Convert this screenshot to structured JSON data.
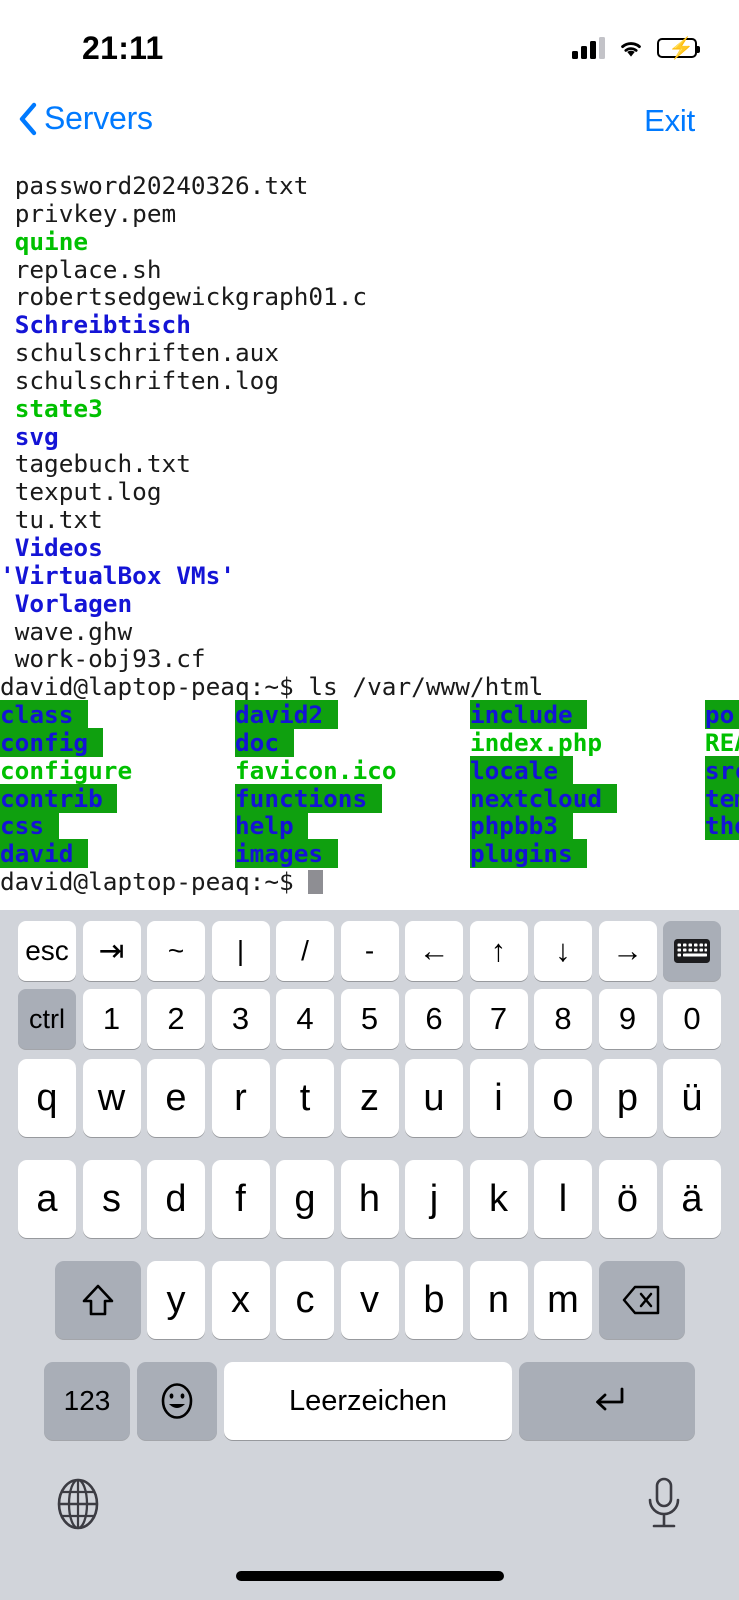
{
  "status_bar": {
    "time": "21:11",
    "cellular_icon": "cellular-bars-icon",
    "wifi_icon": "wifi-icon",
    "battery_icon": "battery-charging-icon"
  },
  "nav_bar": {
    "back_icon": "chevron-left-icon",
    "back_label": "Servers",
    "exit_label": "Exit",
    "accent_color": "#007aff"
  },
  "terminal": {
    "colors": {
      "file": "#1a1a1a",
      "directory": "#1414d6",
      "executable": "#00c000",
      "world_writable_dir_bg": "#0fa00f",
      "cursor": "#8e8e93",
      "background": "#ffffff"
    },
    "home_listing": [
      {
        "text": "password20240326.txt",
        "kind": "file"
      },
      {
        "text": "privkey.pem",
        "kind": "file"
      },
      {
        "text": "quine",
        "kind": "executable"
      },
      {
        "text": "replace.sh",
        "kind": "file"
      },
      {
        "text": "robertsedgewickgraph01.c",
        "kind": "file"
      },
      {
        "text": "Schreibtisch",
        "kind": "directory"
      },
      {
        "text": "schulschriften.aux",
        "kind": "file"
      },
      {
        "text": "schulschriften.log",
        "kind": "file"
      },
      {
        "text": "state3",
        "kind": "executable"
      },
      {
        "text": "svg",
        "kind": "directory"
      },
      {
        "text": "tagebuch.txt",
        "kind": "file"
      },
      {
        "text": "texput.log",
        "kind": "file"
      },
      {
        "text": "tu.txt",
        "kind": "file"
      },
      {
        "text": "Videos",
        "kind": "directory"
      },
      {
        "text": "'VirtualBox VMs'",
        "kind": "directory",
        "no_indent": true
      },
      {
        "text": "Vorlagen",
        "kind": "directory"
      },
      {
        "text": "wave.ghw",
        "kind": "file"
      },
      {
        "text": "work-obj93.cf",
        "kind": "file"
      }
    ],
    "command_line": {
      "prompt": "david@laptop-peaq:~$ ",
      "command": "ls /var/www/html"
    },
    "html_listing_columns": 4,
    "html_listing_rows": [
      [
        {
          "text": "class",
          "kind": "world_writable_dir"
        },
        {
          "text": "david2",
          "kind": "world_writable_dir"
        },
        {
          "text": "include",
          "kind": "world_writable_dir"
        },
        {
          "text": "po",
          "kind": "world_writable_dir"
        }
      ],
      [
        {
          "text": "config",
          "kind": "world_writable_dir"
        },
        {
          "text": "doc",
          "kind": "world_writable_dir"
        },
        {
          "text": "index.php",
          "kind": "executable"
        },
        {
          "text": "README",
          "kind": "executable"
        }
      ],
      [
        {
          "text": "configure",
          "kind": "executable"
        },
        {
          "text": "favicon.ico",
          "kind": "executable"
        },
        {
          "text": "locale",
          "kind": "world_writable_dir"
        },
        {
          "text": "src",
          "kind": "world_writable_dir"
        }
      ],
      [
        {
          "text": "contrib",
          "kind": "world_writable_dir"
        },
        {
          "text": "functions",
          "kind": "world_writable_dir"
        },
        {
          "text": "nextcloud",
          "kind": "world_writable_dir"
        },
        {
          "text": "templates",
          "kind": "world_writable_dir"
        }
      ],
      [
        {
          "text": "css",
          "kind": "world_writable_dir"
        },
        {
          "text": "help",
          "kind": "world_writable_dir"
        },
        {
          "text": "phpbb3",
          "kind": "world_writable_dir"
        },
        {
          "text": "themes",
          "kind": "world_writable_dir"
        }
      ],
      [
        {
          "text": "david",
          "kind": "world_writable_dir"
        },
        {
          "text": "images",
          "kind": "world_writable_dir"
        },
        {
          "text": "plugins",
          "kind": "world_writable_dir"
        },
        {
          "text": "",
          "kind": "empty"
        }
      ]
    ],
    "final_prompt": "david@laptop-peaq:~$ ",
    "cursor_visible": true
  },
  "keyboard": {
    "layout": "QWERTZ (German)",
    "accessory_row": [
      {
        "label": "esc",
        "name": "esc-key",
        "type": "text"
      },
      {
        "label": "⇥",
        "name": "tab-key",
        "type": "icon"
      },
      {
        "label": "~",
        "name": "tilde-key",
        "type": "text"
      },
      {
        "label": "|",
        "name": "pipe-key",
        "type": "text"
      },
      {
        "label": "/",
        "name": "slash-key",
        "type": "text"
      },
      {
        "label": "-",
        "name": "hyphen-key",
        "type": "text"
      },
      {
        "label": "←",
        "name": "arrow-left-key",
        "type": "icon"
      },
      {
        "label": "↑",
        "name": "arrow-up-key",
        "type": "icon"
      },
      {
        "label": "↓",
        "name": "arrow-down-key",
        "type": "icon"
      },
      {
        "label": "→",
        "name": "arrow-right-key",
        "type": "icon"
      },
      {
        "label": "",
        "name": "hide-keyboard-key",
        "type": "glyph",
        "dark": true
      }
    ],
    "number_row": [
      {
        "label": "ctrl",
        "name": "ctrl-key",
        "dark": true
      },
      {
        "label": "1",
        "name": "digit-1-key"
      },
      {
        "label": "2",
        "name": "digit-2-key"
      },
      {
        "label": "3",
        "name": "digit-3-key"
      },
      {
        "label": "4",
        "name": "digit-4-key"
      },
      {
        "label": "5",
        "name": "digit-5-key"
      },
      {
        "label": "6",
        "name": "digit-6-key"
      },
      {
        "label": "7",
        "name": "digit-7-key"
      },
      {
        "label": "8",
        "name": "digit-8-key"
      },
      {
        "label": "9",
        "name": "digit-9-key"
      },
      {
        "label": "0",
        "name": "digit-0-key"
      }
    ],
    "row_q": [
      "q",
      "w",
      "e",
      "r",
      "t",
      "z",
      "u",
      "i",
      "o",
      "p",
      "ü"
    ],
    "row_a": [
      "a",
      "s",
      "d",
      "f",
      "g",
      "h",
      "j",
      "k",
      "l",
      "ö",
      "ä"
    ],
    "row_z": [
      "y",
      "x",
      "c",
      "v",
      "b",
      "n",
      "m"
    ],
    "shift_key": {
      "name": "shift-key",
      "icon": "shift-arrow-up-icon"
    },
    "backspace_key": {
      "name": "backspace-key",
      "icon": "delete-left-icon"
    },
    "bottom_row": {
      "numbers_label": "123",
      "emoji_icon": "emoji-smiley-icon",
      "space_label": "Leerzeichen",
      "return_icon": "return-arrow-icon"
    },
    "globe_icon": "globe-language-icon",
    "mic_icon": "microphone-dictation-icon",
    "key_bg": "#ffffff",
    "key_modifier_bg": "#a9aeb7",
    "keyboard_bg": "#d1d4da"
  }
}
